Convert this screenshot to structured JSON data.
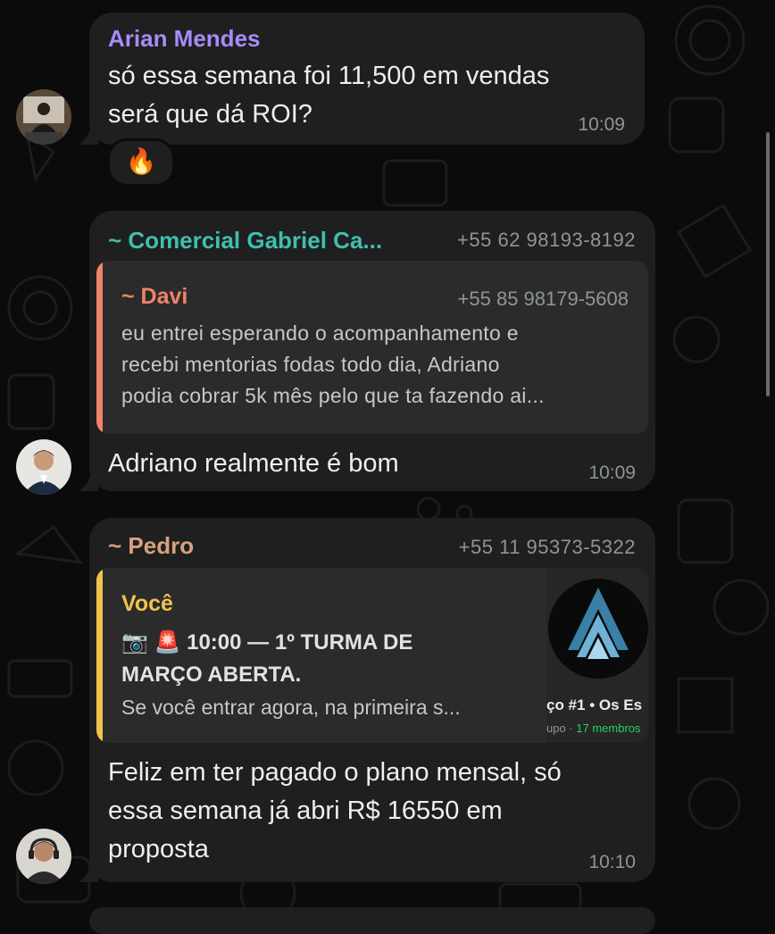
{
  "messages": [
    {
      "sender": "Arian Mendes",
      "text_lines": [
        "só essa semana foi 11,500 em vendas",
        "será que dá ROI?"
      ],
      "time": "10:09",
      "reaction": "🔥"
    },
    {
      "sender": "~ Comercial Gabriel Ca...",
      "phone": "+55 62 98193-8192",
      "quote": {
        "sender": "~ Davi",
        "phone": "+55 85 98179-5608",
        "lines": [
          "eu entrei esperando o acompanhamento e",
          "recebi mentorias fodas todo dia, Adriano",
          "podia cobrar 5k mês pelo que ta fazendo ai..."
        ]
      },
      "text": "Adriano realmente é bom",
      "time": "10:09"
    },
    {
      "sender": "~ Pedro",
      "phone": "+55 11 95373-5322",
      "quote": {
        "sender": "Você",
        "line1": "📷 🚨 10:00 — 1º TURMA DE",
        "line2": "MARÇO ABERTA.",
        "line3": "Se você entrar agora, na primeira s...",
        "thumb_title": "ço #1 • Os Es",
        "thumb_sub_prefix": "upo · ",
        "thumb_sub_members": "17 membros"
      },
      "text_lines": [
        "Feliz em ter pagado o plano mensal, só",
        "essa semana já abri R$ 16550 em",
        "proposta"
      ],
      "time": "10:10"
    }
  ],
  "colors": {
    "background": "#0b0b0b",
    "bubble": "#1f1f1f",
    "quote_bg": "#2b2b2b",
    "arian": "#a78bfa",
    "comercial": "#3fbfae",
    "davi": "#f0836a",
    "pedro": "#d9a07e",
    "voce": "#f2c24e"
  }
}
